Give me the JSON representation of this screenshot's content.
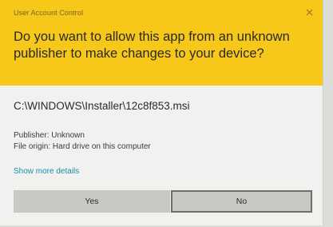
{
  "dialog": {
    "header_title": "User Account Control",
    "question": "Do you want to allow this app from an unknown publisher to make changes to your device?",
    "file_path": "C:\\WINDOWS\\Installer\\12c8f853.msi",
    "publisher": "Publisher: Unknown",
    "file_origin": "File origin: Hard drive on this computer",
    "show_details": "Show more details",
    "yes_label": "Yes",
    "no_label": "No"
  },
  "colors": {
    "header_bg": "#f7c71a",
    "body_bg": "#f1f1ef",
    "link": "#1b8fa8",
    "button_bg": "#c8c8c4",
    "focus_border": "#6d6d69"
  },
  "icons": {
    "close": "close-icon"
  }
}
